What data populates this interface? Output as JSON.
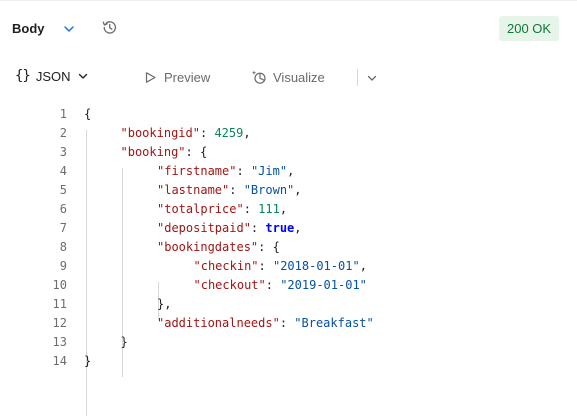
{
  "response_header": {
    "body_tab_label": "Body",
    "status": "200 OK",
    "status_color": "#0b7a3b"
  },
  "toolbar": {
    "format_braces": "{}",
    "format_label": "JSON",
    "preview_label": "Preview",
    "visualize_label": "Visualize"
  },
  "icons": [
    "chevron-down-icon",
    "history-icon",
    "play-outline-icon",
    "visualize-icon"
  ],
  "editor": {
    "lines": [
      {
        "n": "1",
        "tokens": [
          {
            "t": "{",
            "c": "punc"
          }
        ]
      },
      {
        "n": "2",
        "tokens": [
          {
            "t": "\"bookingid\"",
            "c": "key"
          },
          {
            "t": ": ",
            "c": "punc"
          },
          {
            "t": "4259",
            "c": "num"
          },
          {
            "t": ",",
            "c": "punc"
          }
        ]
      },
      {
        "n": "3",
        "tokens": [
          {
            "t": "\"booking\"",
            "c": "key"
          },
          {
            "t": ": {",
            "c": "punc"
          }
        ]
      },
      {
        "n": "4",
        "tokens": [
          {
            "t": "\"firstname\"",
            "c": "key"
          },
          {
            "t": ": ",
            "c": "punc"
          },
          {
            "t": "\"Jim\"",
            "c": "str"
          },
          {
            "t": ",",
            "c": "punc"
          }
        ]
      },
      {
        "n": "5",
        "tokens": [
          {
            "t": "\"lastname\"",
            "c": "key"
          },
          {
            "t": ": ",
            "c": "punc"
          },
          {
            "t": "\"Brown\"",
            "c": "str"
          },
          {
            "t": ",",
            "c": "punc"
          }
        ]
      },
      {
        "n": "6",
        "tokens": [
          {
            "t": "\"totalprice\"",
            "c": "key"
          },
          {
            "t": ": ",
            "c": "punc"
          },
          {
            "t": "111",
            "c": "num"
          },
          {
            "t": ",",
            "c": "punc"
          }
        ]
      },
      {
        "n": "7",
        "tokens": [
          {
            "t": "\"depositpaid\"",
            "c": "key"
          },
          {
            "t": ": ",
            "c": "punc"
          },
          {
            "t": "true",
            "c": "bool"
          },
          {
            "t": ",",
            "c": "punc"
          }
        ]
      },
      {
        "n": "8",
        "tokens": [
          {
            "t": "\"bookingdates\"",
            "c": "key"
          },
          {
            "t": ": {",
            "c": "punc"
          }
        ]
      },
      {
        "n": "9",
        "tokens": [
          {
            "t": "\"checkin\"",
            "c": "key"
          },
          {
            "t": ": ",
            "c": "punc"
          },
          {
            "t": "\"2018-01-01\"",
            "c": "str"
          },
          {
            "t": ",",
            "c": "punc"
          }
        ]
      },
      {
        "n": "10",
        "tokens": [
          {
            "t": "\"checkout\"",
            "c": "key"
          },
          {
            "t": ": ",
            "c": "punc"
          },
          {
            "t": "\"2019-01-01\"",
            "c": "str"
          }
        ]
      },
      {
        "n": "11",
        "tokens": [
          {
            "t": "},",
            "c": "punc"
          }
        ]
      },
      {
        "n": "12",
        "tokens": [
          {
            "t": "\"additionalneeds\"",
            "c": "key"
          },
          {
            "t": ": ",
            "c": "punc"
          },
          {
            "t": "\"Breakfast\"",
            "c": "str"
          }
        ]
      },
      {
        "n": "13",
        "tokens": [
          {
            "t": "}",
            "c": "punc"
          }
        ]
      },
      {
        "n": "14",
        "tokens": [
          {
            "t": "}",
            "c": "punc"
          }
        ]
      }
    ]
  }
}
